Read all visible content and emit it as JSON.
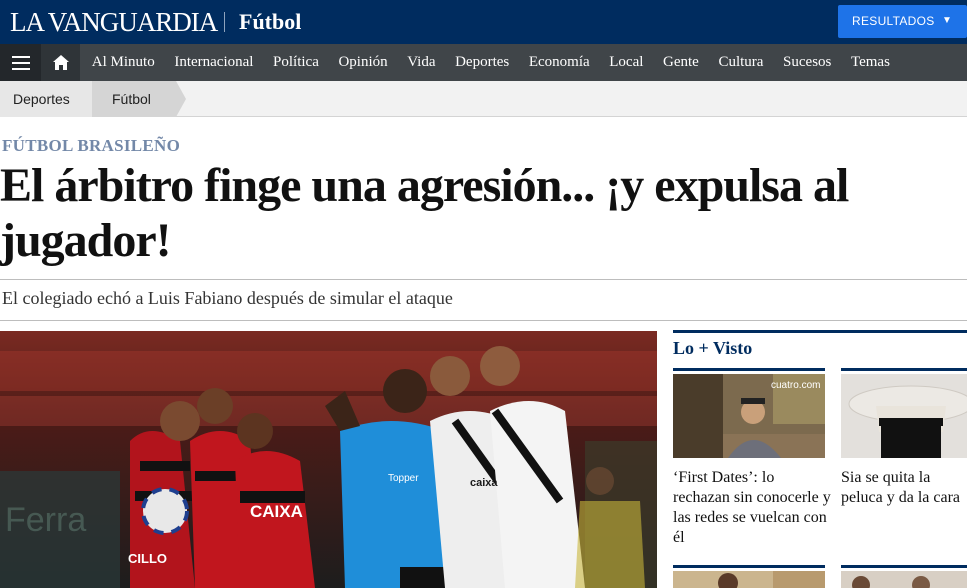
{
  "header": {
    "logo": "LA VANGUARDIA",
    "section": "Fútbol",
    "results_button": "RESULTADOS"
  },
  "nav": {
    "items": [
      "Al Minuto",
      "Internacional",
      "Política",
      "Opinión",
      "Vida",
      "Deportes",
      "Economía",
      "Local",
      "Gente",
      "Cultura",
      "Sucesos",
      "Temas"
    ]
  },
  "breadcrumb": [
    "Deportes",
    "Fútbol"
  ],
  "article": {
    "kicker": "FÚTBOL BRASILEÑO",
    "headline": "El árbitro finge una agresión... ¡y expulsa al jugador!",
    "subtitle": "El colegiado echó a Luis Fabiano después de simular el ataque",
    "photo_texts": [
      "CAIXA",
      "CILLO",
      "Topper",
      "caixa"
    ]
  },
  "sidebar": {
    "title": "Lo + Visto",
    "cards": [
      {
        "title": "‘First Dates’: lo rechazan sin conocerle y las redes se vuelcan con él",
        "thumb_text": "cuatro.com"
      },
      {
        "title": "Sia se quita la peluca y da la cara",
        "thumb_text": ""
      }
    ]
  },
  "colors": {
    "brand_navy": "#002c5f",
    "nav_gray": "#404549",
    "button_blue": "#1e73e8",
    "kicker": "#7388a8"
  },
  "icons": {
    "menu": "hamburger-icon",
    "home": "home-icon",
    "dropdown": "caret-down-icon"
  }
}
